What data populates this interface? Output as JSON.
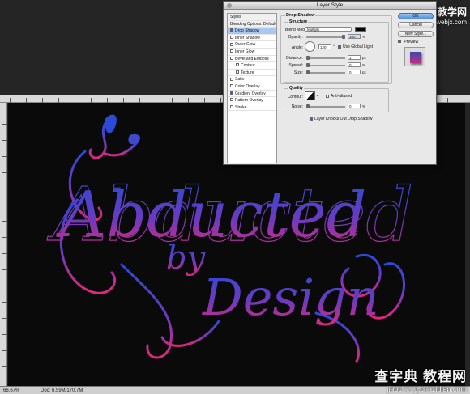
{
  "dialog": {
    "title": "Layer Style",
    "styles_list": [
      {
        "label": "Styles",
        "kind": "head"
      },
      {
        "label": "Blending Options: Default",
        "kind": "head"
      },
      {
        "label": "Drop Shadow",
        "checked": true,
        "selected": true
      },
      {
        "label": "Inner Shadow",
        "checked": false
      },
      {
        "label": "Outer Glow",
        "checked": false
      },
      {
        "label": "Inner Glow",
        "checked": false
      },
      {
        "label": "Bevel and Emboss",
        "checked": false
      },
      {
        "label": "Contour",
        "checked": false,
        "indent": true
      },
      {
        "label": "Texture",
        "checked": false,
        "indent": true
      },
      {
        "label": "Satin",
        "checked": false
      },
      {
        "label": "Color Overlay",
        "checked": false
      },
      {
        "label": "Gradient Overlay",
        "checked": true
      },
      {
        "label": "Pattern Overlay",
        "checked": false
      },
      {
        "label": "Stroke",
        "checked": false
      }
    ],
    "drop_shadow": {
      "section_title": "Drop Shadow",
      "structure_title": "Structure",
      "blend_mode_label": "Blend Mode:",
      "blend_mode_value": "Multiply",
      "shadow_color": "#000000",
      "opacity_label": "Opacity:",
      "opacity_value": "100",
      "opacity_fraction": 1.0,
      "angle_label": "Angle:",
      "angle_value": "120",
      "global_light_label": "Use Global Light",
      "global_light_checked": true,
      "distance_label": "Distance:",
      "distance_value": "1",
      "distance_fraction": 0.01,
      "spread_label": "Spread:",
      "spread_value": "0",
      "spread_fraction": 0,
      "size_label": "Size:",
      "size_value": "0",
      "size_fraction": 0,
      "quality_title": "Quality",
      "contour_label": "Contour:",
      "anti_aliased_label": "Anti-aliased",
      "anti_aliased_checked": false,
      "noise_label": "Noise:",
      "noise_value": "0",
      "noise_fraction": 0,
      "knockout_label": "Layer Knocks Out Drop Shadow",
      "knockout_checked": true,
      "units": {
        "percent": "%",
        "degree": "°",
        "px": "px"
      }
    },
    "buttons": {
      "ok": "OK",
      "cancel": "Cancel",
      "new_style": "New Style..."
    },
    "preview_label": "Preview",
    "preview_checked": true
  },
  "canvas": {
    "artwork_text": [
      "Abducted",
      "by",
      "Design"
    ],
    "gradient_top": "#2f4fd0",
    "gradient_bottom": "#e0287f"
  },
  "status_bar": {
    "zoom": "66.67%",
    "doc_info": "Doc: 6.59M/170.7M"
  },
  "watermarks": {
    "top_line1": "网页教学网",
    "top_line2": "www.webjx.com",
    "bottom_line1": "查字典 教程网",
    "bottom_line2": "jiaocheng.chazidian.com"
  }
}
